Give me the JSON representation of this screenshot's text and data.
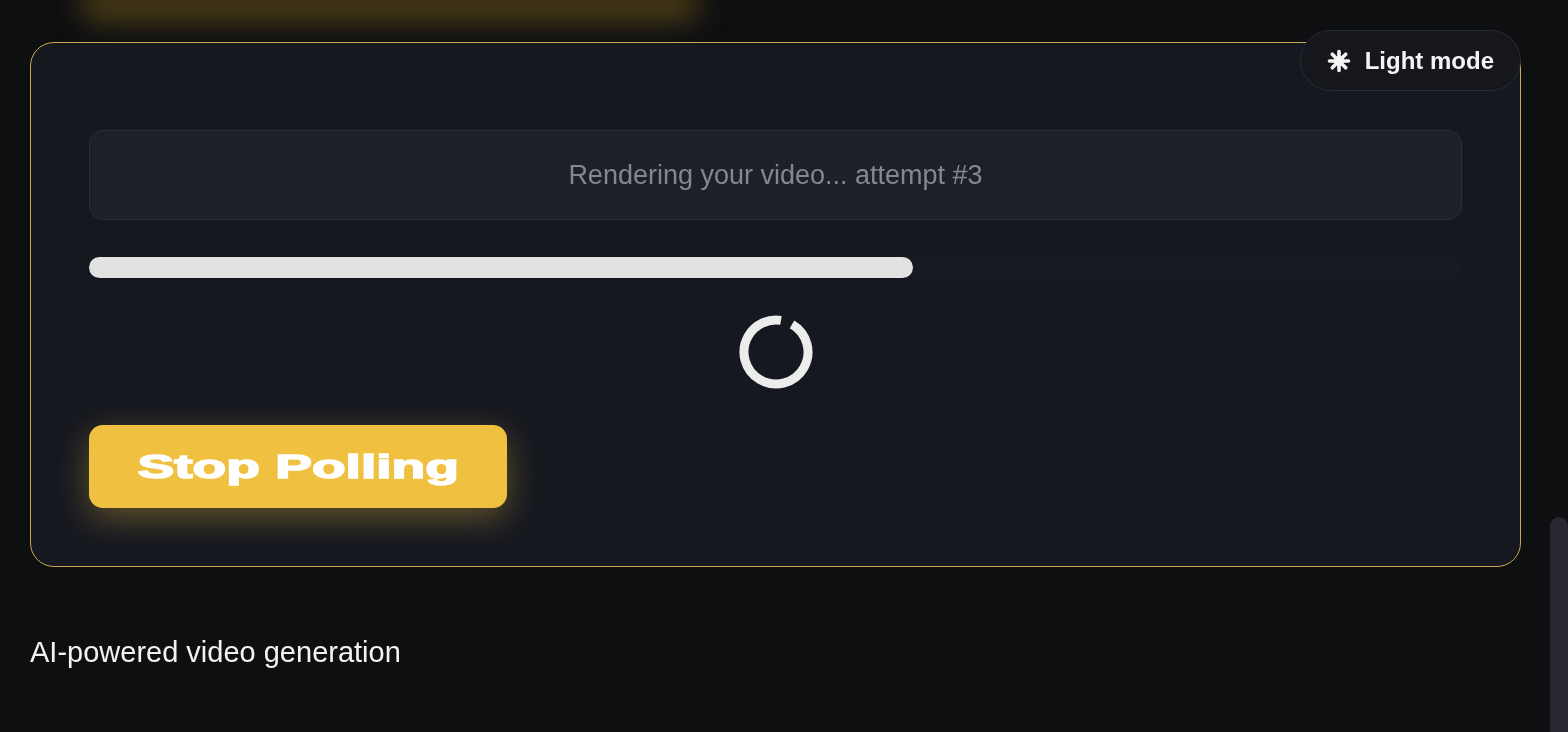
{
  "theme_toggle": {
    "label": "Light mode"
  },
  "status": {
    "message": "Rendering your video... attempt #3"
  },
  "progress": {
    "level": 0.6,
    "loading": true
  },
  "stop_button": {
    "label": "Stop Polling"
  },
  "tagline": "AI-powered video generation"
}
